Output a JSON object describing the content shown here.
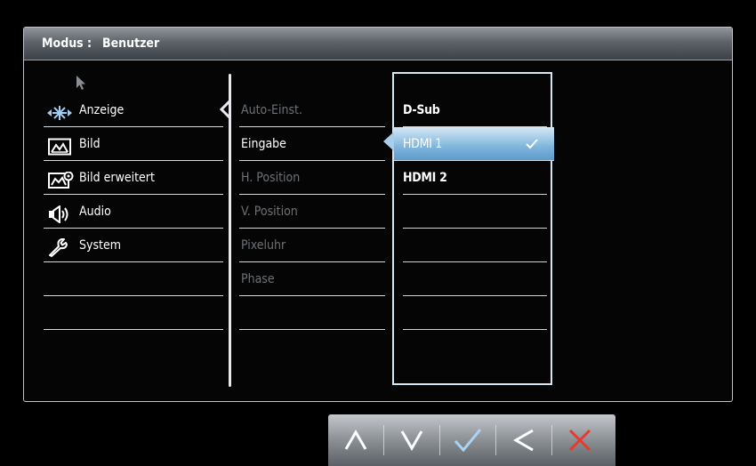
{
  "header": {
    "mode_label": "Modus :",
    "mode_value": "Benutzer"
  },
  "main_menu": [
    {
      "label": "Anzeige",
      "icon": "display-icon"
    },
    {
      "label": "Bild",
      "icon": "picture-icon"
    },
    {
      "label": "Bild erweitert",
      "icon": "picture-advanced-icon"
    },
    {
      "label": "Audio",
      "icon": "speaker-icon"
    },
    {
      "label": "System",
      "icon": "wrench-icon"
    }
  ],
  "sub_menu": [
    {
      "label": "Auto-Einst.",
      "state": "disabled"
    },
    {
      "label": "Eingabe",
      "state": "active"
    },
    {
      "label": "H. Position",
      "state": "disabled"
    },
    {
      "label": "V. Position",
      "state": "disabled"
    },
    {
      "label": "Pixeluhr",
      "state": "disabled"
    },
    {
      "label": "Phase",
      "state": "disabled"
    }
  ],
  "options": [
    {
      "label": "D-Sub"
    },
    {
      "label": "HDMI 1",
      "selected": true
    },
    {
      "label": "HDMI 2"
    }
  ],
  "buttons": [
    "up-button",
    "down-button",
    "confirm-button",
    "back-button",
    "close-button"
  ],
  "colors": {
    "selection": "#7fb5dc",
    "close": "#e8392f"
  }
}
